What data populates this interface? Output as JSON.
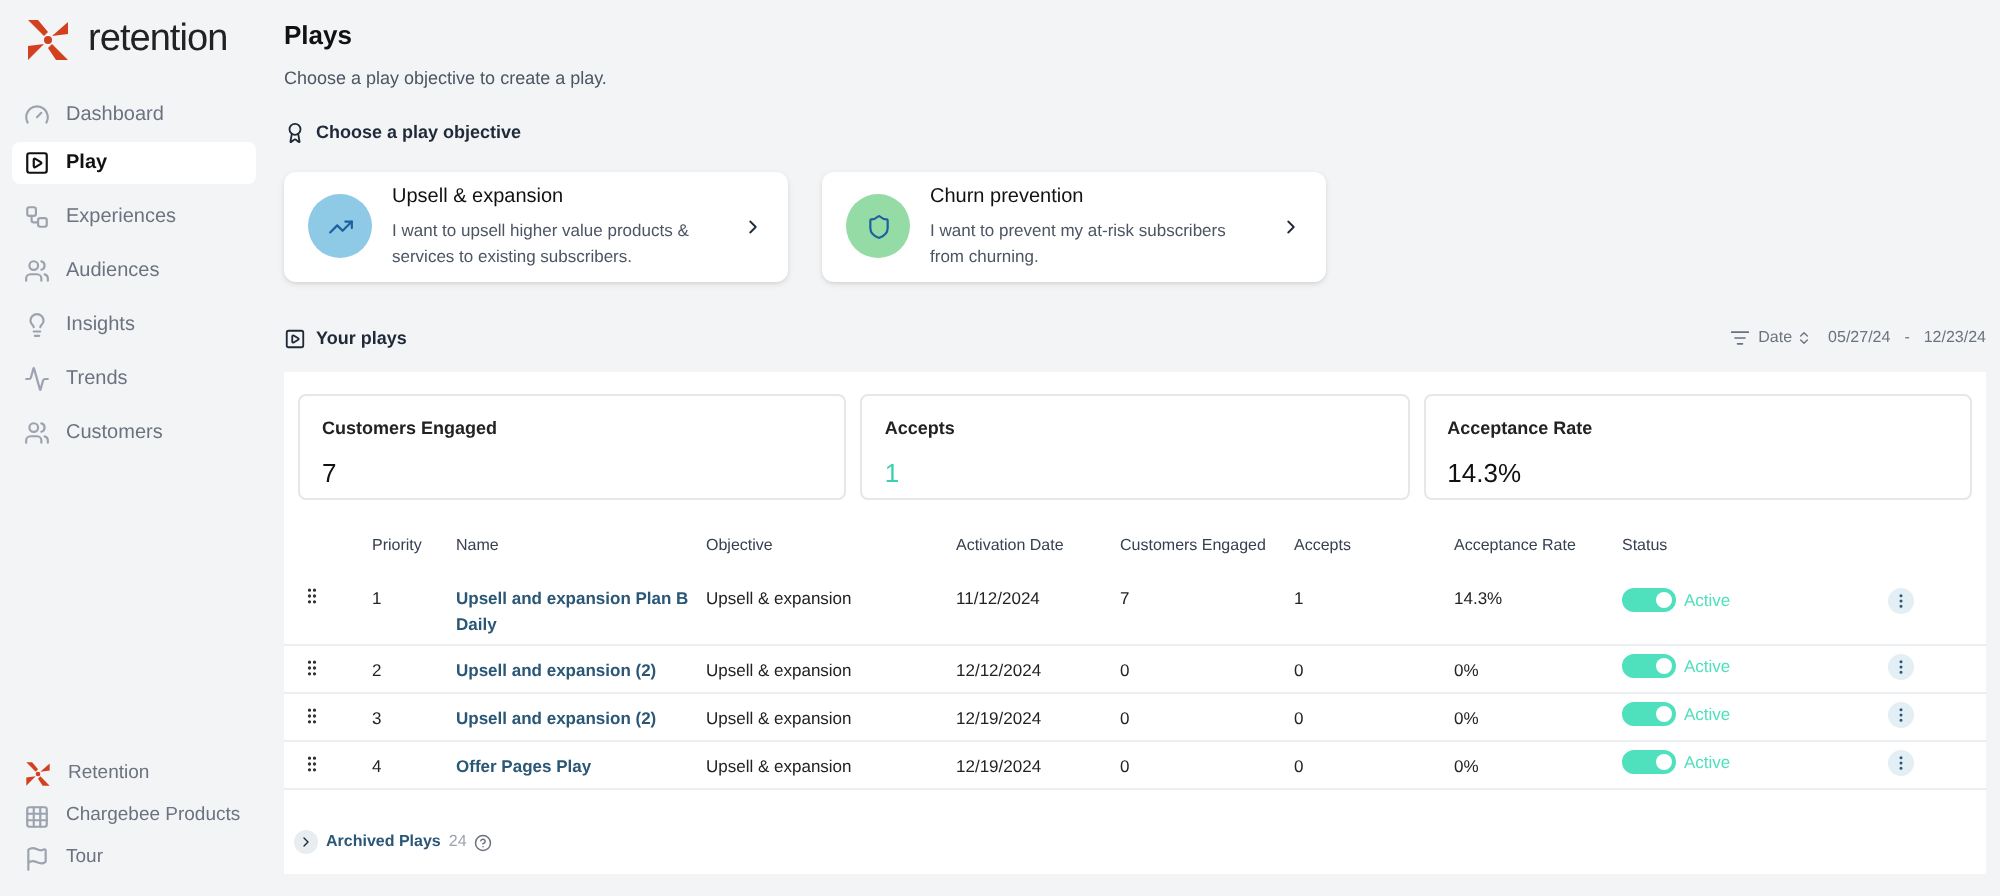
{
  "brand": {
    "name": "retention"
  },
  "sidebar": {
    "items": [
      {
        "label": "Dashboard",
        "selected": false
      },
      {
        "label": "Play",
        "selected": true
      },
      {
        "label": "Experiences",
        "selected": false
      },
      {
        "label": "Audiences",
        "selected": false
      },
      {
        "label": "Insights",
        "selected": false
      },
      {
        "label": "Trends",
        "selected": false
      },
      {
        "label": "Customers",
        "selected": false
      }
    ],
    "footer_items": [
      {
        "label": "Retention"
      },
      {
        "label": "Chargebee Products"
      },
      {
        "label": "Tour"
      }
    ]
  },
  "page": {
    "title": "Plays",
    "subtitle": "Choose a play objective to create a play."
  },
  "objectives": {
    "heading": "Choose a play objective",
    "cards": [
      {
        "kind": "upsell",
        "title": "Upsell & expansion",
        "description": "I want to upsell higher value products & services to existing subscribers.",
        "color": "#8ecae6"
      },
      {
        "kind": "churn",
        "title": "Churn prevention",
        "description": "I want to prevent my at-risk subscribers from churning.",
        "color": "#95dba5"
      }
    ]
  },
  "your_plays": {
    "heading": "Your plays",
    "filter": {
      "label": "Date",
      "start": "05/27/24",
      "separator": "-",
      "end": "12/23/24"
    }
  },
  "stats": [
    {
      "label": "Customers Engaged",
      "value": "7",
      "highlight": false
    },
    {
      "label": "Accepts",
      "value": "1",
      "highlight": true
    },
    {
      "label": "Acceptance Rate",
      "value": "14.3%",
      "highlight": false
    }
  ],
  "table": {
    "columns": [
      "Priority",
      "Name",
      "Objective",
      "Activation Date",
      "Customers Engaged",
      "Accepts",
      "Acceptance Rate",
      "Status"
    ],
    "rows": [
      {
        "priority": "1",
        "name": "Upsell and expansion Plan B Daily",
        "objective": "Upsell & expansion",
        "date": "11/12/2024",
        "engaged": "7",
        "accepts": "1",
        "rate": "14.3%",
        "on": true,
        "status": "Active"
      },
      {
        "priority": "2",
        "name": "Upsell and expansion (2)",
        "objective": "Upsell & expansion",
        "date": "12/12/2024",
        "engaged": "0",
        "accepts": "0",
        "rate": "0%",
        "on": true,
        "status": "Active"
      },
      {
        "priority": "3",
        "name": "Upsell and expansion (2)",
        "objective": "Upsell & expansion",
        "date": "12/19/2024",
        "engaged": "0",
        "accepts": "0",
        "rate": "0%",
        "on": true,
        "status": "Active"
      },
      {
        "priority": "4",
        "name": "Offer Pages Play",
        "objective": "Upsell & expansion",
        "date": "12/19/2024",
        "engaged": "0",
        "accepts": "0",
        "rate": "0%",
        "on": true,
        "status": "Active"
      }
    ]
  },
  "archived": {
    "label": "Archived Plays",
    "count": "24",
    "expanded": false
  }
}
